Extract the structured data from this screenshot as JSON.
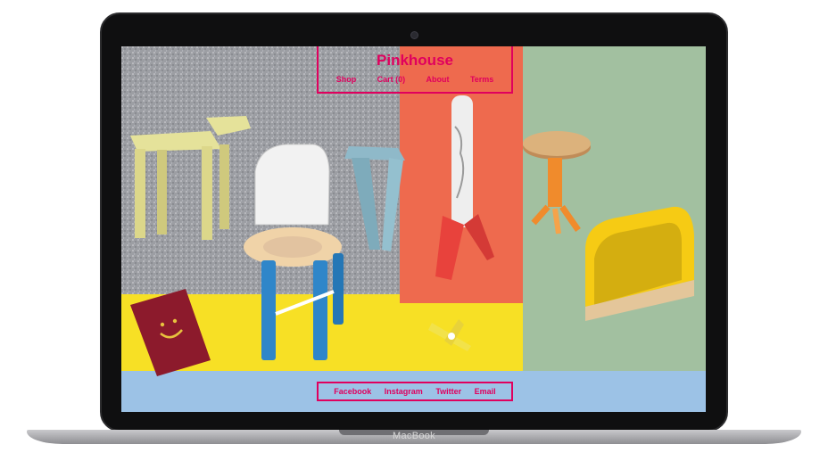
{
  "site": {
    "title": "Pinkhouse",
    "nav": [
      "Shop",
      "Cart (0)",
      "About",
      "Terms"
    ],
    "footer": [
      "Facebook",
      "Instagram",
      "Twitter",
      "Email"
    ],
    "accent": "#e0005e"
  },
  "device": {
    "label": "MacBook"
  },
  "icons": {
    "camera": "webcam-icon"
  }
}
